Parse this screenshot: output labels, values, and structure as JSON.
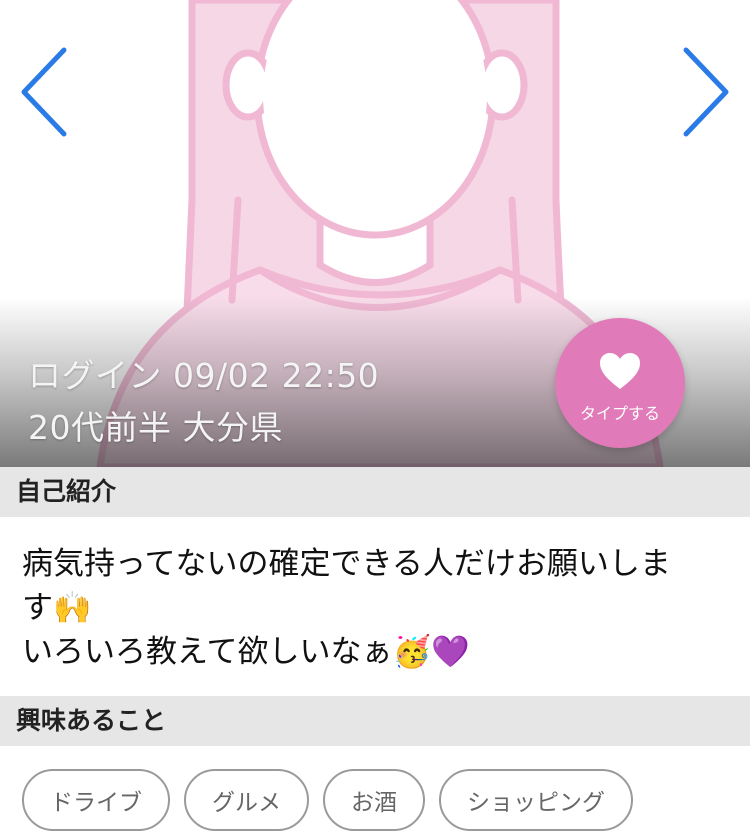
{
  "profile": {
    "login_text": "ログイン 09/02 22:50",
    "age_location": "20代前半 大分県"
  },
  "actions": {
    "like_label": "タイプする",
    "prev_icon": "chevron-left-icon",
    "next_icon": "chevron-right-icon",
    "like_icon": "heart-icon"
  },
  "intro": {
    "heading": "自己紹介",
    "lines": [
      "病気持ってないの確定できる人だけお願いしま",
      "す🙌",
      "いろいろ教えて欲しいなぁ🥳💜"
    ]
  },
  "interests": {
    "heading": "興味あること",
    "tags": [
      "ドライブ",
      "グルメ",
      "お酒",
      "ショッピング"
    ]
  },
  "colors": {
    "accent": "#e07ab8",
    "nav_arrow": "#2b7be6",
    "avatar_pink": "#f3c7dd",
    "avatar_fill": "#f6d7e6",
    "section_bg": "#e6e6e6"
  }
}
